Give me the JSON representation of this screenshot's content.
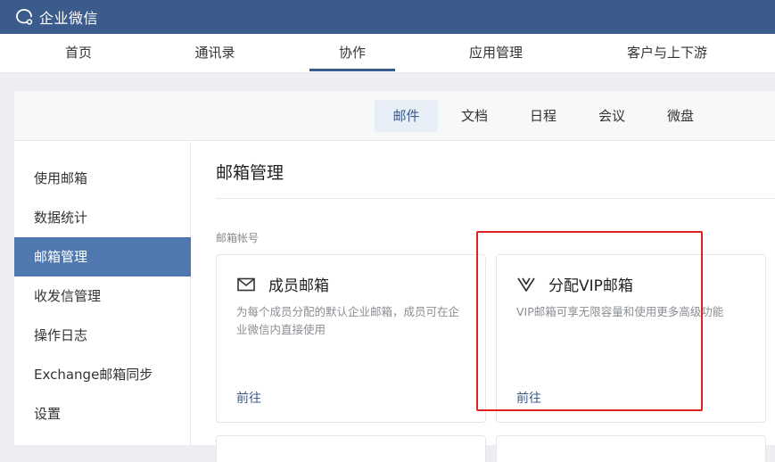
{
  "app": {
    "title": "企业微信"
  },
  "main_nav": [
    "首页",
    "通讯录",
    "协作",
    "应用管理",
    "客户与上下游"
  ],
  "sub_nav": [
    "邮件",
    "文档",
    "日程",
    "会议",
    "微盘"
  ],
  "sidebar": [
    "使用邮箱",
    "数据统计",
    "邮箱管理",
    "收发信管理",
    "操作日志",
    "Exchange邮箱同步",
    "设置"
  ],
  "content": {
    "title": "邮箱管理",
    "section_label": "邮箱帐号",
    "cards": [
      {
        "icon": "mail-icon",
        "title": "成员邮箱",
        "desc": "为每个成员分配的默认企业邮箱，成员可在企业微信内直接使用",
        "link": "前往"
      },
      {
        "icon": "vip-v-icon",
        "title": "分配VIP邮箱",
        "desc": "VIP邮箱可享无限容量和使用更多高级功能",
        "link": "前往"
      }
    ]
  },
  "colors": {
    "brand": "#3b5b8c",
    "sidebar_active": "#4f79ae",
    "highlight": "#e02020"
  }
}
